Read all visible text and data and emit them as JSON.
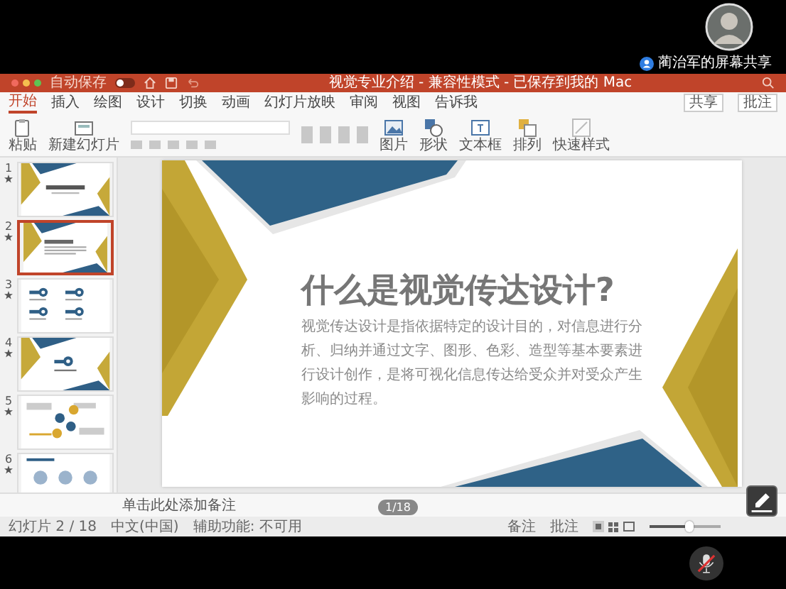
{
  "meeting": {
    "share_label": "蔺治军的屏幕共享",
    "mic_muted": true
  },
  "window": {
    "title": "视觉专业介绍 - 兼容性模式 - 已保存到我的 Mac",
    "autosave_label": "自动保存",
    "autosave_on": false
  },
  "tabs": [
    {
      "label": "开始",
      "selected": true
    },
    {
      "label": "插入",
      "selected": false
    },
    {
      "label": "绘图",
      "selected": false
    },
    {
      "label": "设计",
      "selected": false
    },
    {
      "label": "切换",
      "selected": false
    },
    {
      "label": "动画",
      "selected": false
    },
    {
      "label": "幻灯片放映",
      "selected": false
    },
    {
      "label": "审阅",
      "selected": false
    },
    {
      "label": "视图",
      "selected": false
    },
    {
      "label": "告诉我",
      "selected": false
    }
  ],
  "header_buttons": [
    "共享",
    "批注"
  ],
  "ribbon": {
    "left": [
      {
        "kind": "paste",
        "label": "粘贴"
      },
      {
        "kind": "new-slide",
        "label": "新建幻灯片"
      }
    ],
    "right": [
      {
        "kind": "picture",
        "label": "图片"
      },
      {
        "kind": "shape",
        "label": "形状"
      },
      {
        "kind": "textbox",
        "label": "文本框"
      },
      {
        "kind": "arrange",
        "label": "排列"
      },
      {
        "kind": "style",
        "label": "快速样式"
      }
    ]
  },
  "slides": [
    {
      "number": "1",
      "kind": "cover",
      "selected": false
    },
    {
      "number": "2",
      "kind": "text",
      "selected": true
    },
    {
      "number": "3",
      "kind": "icons",
      "selected": false
    },
    {
      "number": "4",
      "kind": "section",
      "selected": false
    },
    {
      "number": "5",
      "kind": "diagram",
      "selected": false
    },
    {
      "number": "6",
      "kind": "chart",
      "selected": false
    }
  ],
  "slide": {
    "title": "什么是视觉传达设计?",
    "body": "视觉传达设计是指依据特定的设计目的，对信息进行分析、归纳并通过文字、图形、色彩、造型等基本要素进行设计创作，是将可视化信息传达给受众并对受众产生影响的过程。"
  },
  "notes": {
    "placeholder": "单击此处添加备注"
  },
  "page_indicator": "1/18",
  "status": {
    "slide": "幻灯片 2 / 18",
    "language": "中文(中国)",
    "accessibility": "辅助功能: 不可用",
    "notes": "备注",
    "comments": "批注",
    "zoom": {
      "level": 0.55
    }
  }
}
